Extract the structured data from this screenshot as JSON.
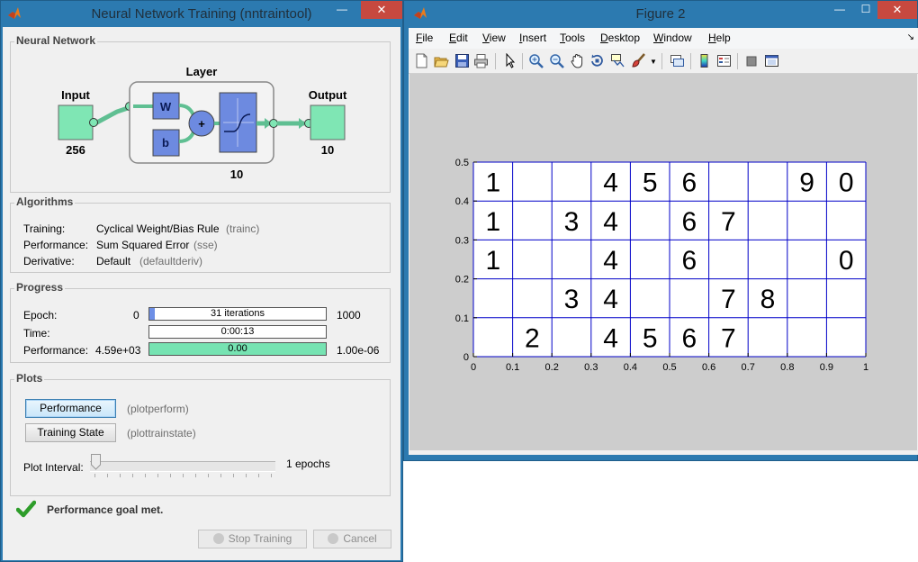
{
  "trainwin": {
    "title": "Neural Network Training (nntraintool)",
    "nn_panel_label": "Neural Network",
    "input_label": "Input",
    "input_size": "256",
    "layer_label": "Layer",
    "layer_size": "10",
    "output_label": "Output",
    "output_size": "10",
    "w_label": "W",
    "b_label": "b",
    "sum_label": "+",
    "algorithms_label": "Algorithms",
    "algorithms": [
      {
        "name": "Training:",
        "value": "Cyclical Weight/Bias Rule",
        "fn": "(trainc)"
      },
      {
        "name": "Performance:",
        "value": "Sum Squared Error",
        "fn": "(sse)"
      },
      {
        "name": "Derivative:",
        "value": "Default",
        "fn": "(defaultderiv)"
      }
    ],
    "progress_label": "Progress",
    "progress": {
      "epoch": {
        "name": "Epoch:",
        "start": "0",
        "bar": "31 iterations",
        "end": "1000",
        "fraction": 0.031
      },
      "time": {
        "name": "Time:",
        "bar": "0:00:13"
      },
      "performance": {
        "name": "Performance:",
        "start": "4.59e+03",
        "bar": "0.00",
        "end": "1.00e-06",
        "fraction": 1.0
      }
    },
    "plots_label": "Plots",
    "plots": [
      {
        "label": "Performance",
        "fn": "(plotperform)"
      },
      {
        "label": "Training State",
        "fn": "(plottrainstate)"
      }
    ],
    "plot_interval_label": "Plot Interval:",
    "plot_interval_value": "1 epochs",
    "status": "Performance goal met.",
    "stop_label": "Stop Training",
    "cancel_label": "Cancel",
    "colors": {
      "fill_blue": "#6e8fe6",
      "fill_green": "#76e3b2",
      "node_green": "#7fe6b4",
      "box_blue": "#6d8ae0"
    }
  },
  "figwin": {
    "title": "Figure 2",
    "menus": [
      {
        "label": "File",
        "u": "F",
        "rest": "ile"
      },
      {
        "label": "Edit",
        "u": "E",
        "rest": "dit"
      },
      {
        "label": "View",
        "u": "V",
        "rest": "iew"
      },
      {
        "label": "Insert",
        "u": "I",
        "rest": "nsert"
      },
      {
        "label": "Tools",
        "u": "T",
        "rest": "ools"
      },
      {
        "label": "Desktop",
        "u": "D",
        "rest": "esktop"
      },
      {
        "label": "Window",
        "u": "W",
        "rest": "indow"
      },
      {
        "label": "Help",
        "u": "H",
        "rest": "elp"
      }
    ],
    "toolbar_icons": [
      "new-figure-icon",
      "open-icon",
      "save-icon",
      "print-icon",
      "pointer-icon",
      "zoom-in-icon",
      "zoom-out-icon",
      "pan-icon",
      "rotate-icon",
      "data-cursor-icon",
      "brush-icon",
      "link-icon",
      "colorbar-icon",
      "legend-icon",
      "hide-plot-tools-icon",
      "show-plot-tools-icon"
    ]
  },
  "chart_data": {
    "type": "table",
    "title": "",
    "xlabel": "",
    "ylabel": "",
    "xlim": [
      0,
      1
    ],
    "ylim": [
      0,
      0.5
    ],
    "x_ticks": [
      "0",
      "0.1",
      "0.2",
      "0.3",
      "0.4",
      "0.5",
      "0.6",
      "0.7",
      "0.8",
      "0.9",
      "1"
    ],
    "y_ticks": [
      "0",
      "0.1",
      "0.2",
      "0.3",
      "0.4",
      "0.5"
    ],
    "grid_color": "#0000c8",
    "rows": [
      [
        "1",
        "",
        "",
        "4",
        "5",
        "6",
        "",
        "",
        "9",
        "0"
      ],
      [
        "1",
        "",
        "3",
        "4",
        "",
        "6",
        "7",
        "",
        "",
        ""
      ],
      [
        "1",
        "",
        "",
        "4",
        "",
        "6",
        "",
        "",
        "",
        "0"
      ],
      [
        "",
        "",
        "3",
        "4",
        "",
        "",
        "7",
        "8",
        "",
        ""
      ],
      [
        "",
        "2",
        "",
        "4",
        "5",
        "6",
        "7",
        "",
        "",
        ""
      ]
    ]
  }
}
